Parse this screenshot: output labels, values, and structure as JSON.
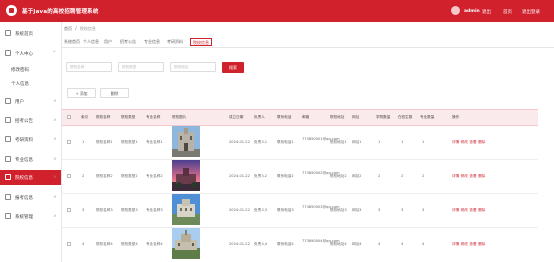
{
  "header": {
    "title": "基于Java的高校招聘管理系统",
    "username": "admin",
    "links": [
      "退出",
      "首页",
      "退出登录"
    ]
  },
  "sidebar": {
    "items": [
      {
        "label": "系统首页",
        "icon": "home-icon"
      },
      {
        "label": "个人中心",
        "icon": "user-icon",
        "arrow": "^"
      },
      {
        "label": "修改密码",
        "sub": true
      },
      {
        "label": "个人信息",
        "sub": true
      },
      {
        "label": "用户",
        "icon": "user-icon",
        "arrow": "v"
      },
      {
        "label": "招考公告",
        "icon": "doc-icon",
        "arrow": "v"
      },
      {
        "label": "考研资料",
        "icon": "book-icon",
        "arrow": "v"
      },
      {
        "label": "专业信息",
        "icon": "list-icon",
        "arrow": "v"
      },
      {
        "label": "院校信息",
        "icon": "flag-icon",
        "arrow": "v",
        "active": true
      },
      {
        "label": "报考信息",
        "icon": "file-icon",
        "arrow": "v"
      },
      {
        "label": "系统管理",
        "icon": "gear-icon",
        "arrow": "v"
      }
    ]
  },
  "breadcrumb": {
    "home": "首页",
    "current": "院校信息"
  },
  "tabs": [
    "系统首页",
    "个人信息",
    "用户",
    "招考公告",
    "专业信息",
    "考研资料",
    "院校信息"
  ],
  "search": {
    "placeholder_1": "院校名称",
    "placeholder_2": "院校类型",
    "placeholder_3": "院校地址",
    "button": "搜索"
  },
  "actions": {
    "add": "+ 添加",
    "delete": "删除"
  },
  "table": {
    "columns": [
      "索引",
      "院校名称",
      "院校类型",
      "专业名称",
      "院校图片",
      "成立日期",
      "负责人",
      "联系电话",
      "邮箱",
      "院校地址",
      "网址",
      "学院数量",
      "在校生数",
      "专业数量",
      "操作"
    ],
    "action_labels": [
      "详情",
      "修改",
      "查看",
      "删除"
    ],
    "rows": [
      {
        "index": "1",
        "name": "院校名称1",
        "type": "院校类型1",
        "major": "专业名称1",
        "date": "2024-01-22",
        "leader": "负责人1",
        "phone": "联系电话1",
        "email": "773890001@qq.com",
        "address": "院校地址1",
        "site": "网址1",
        "colleges": "1",
        "students": "1",
        "majors": "1"
      },
      {
        "index": "2",
        "name": "院校名称2",
        "type": "院校类型2",
        "major": "专业名称2",
        "date": "2024-01-22",
        "leader": "负责人2",
        "phone": "联系电话2",
        "email": "773890002@qq.com",
        "address": "院校地址2",
        "site": "网址2",
        "colleges": "2",
        "students": "2",
        "majors": "2"
      },
      {
        "index": "3",
        "name": "院校名称3",
        "type": "院校类型3",
        "major": "专业名称3",
        "date": "2024-01-22",
        "leader": "负责人3",
        "phone": "联系电话3",
        "email": "773890003@qq.com",
        "address": "院校地址3",
        "site": "网址3",
        "colleges": "3",
        "students": "3",
        "majors": "3"
      },
      {
        "index": "4",
        "name": "院校名称4",
        "type": "院校类型4",
        "major": "专业名称4",
        "date": "2024-01-22",
        "leader": "负责人4",
        "phone": "联系电话4",
        "email": "773890004@qq.com",
        "address": "院校地址4",
        "site": "网址4",
        "colleges": "4",
        "students": "4",
        "majors": "4"
      }
    ]
  },
  "colors": {
    "accent": "#d0212d",
    "header_row": "#fbeaeb"
  }
}
